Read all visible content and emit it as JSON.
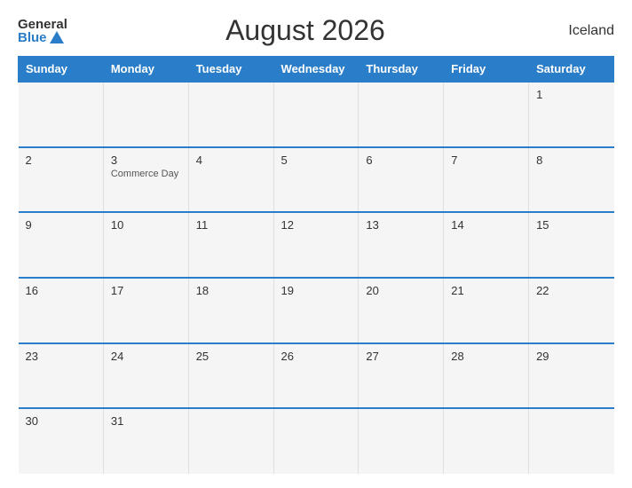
{
  "header": {
    "logo_general": "General",
    "logo_blue": "Blue",
    "title": "August 2026",
    "country": "Iceland"
  },
  "weekdays": [
    "Sunday",
    "Monday",
    "Tuesday",
    "Wednesday",
    "Thursday",
    "Friday",
    "Saturday"
  ],
  "weeks": [
    [
      {
        "day": "",
        "holiday": ""
      },
      {
        "day": "",
        "holiday": ""
      },
      {
        "day": "",
        "holiday": ""
      },
      {
        "day": "",
        "holiday": ""
      },
      {
        "day": "",
        "holiday": ""
      },
      {
        "day": "",
        "holiday": ""
      },
      {
        "day": "1",
        "holiday": ""
      }
    ],
    [
      {
        "day": "2",
        "holiday": ""
      },
      {
        "day": "3",
        "holiday": "Commerce Day"
      },
      {
        "day": "4",
        "holiday": ""
      },
      {
        "day": "5",
        "holiday": ""
      },
      {
        "day": "6",
        "holiday": ""
      },
      {
        "day": "7",
        "holiday": ""
      },
      {
        "day": "8",
        "holiday": ""
      }
    ],
    [
      {
        "day": "9",
        "holiday": ""
      },
      {
        "day": "10",
        "holiday": ""
      },
      {
        "day": "11",
        "holiday": ""
      },
      {
        "day": "12",
        "holiday": ""
      },
      {
        "day": "13",
        "holiday": ""
      },
      {
        "day": "14",
        "holiday": ""
      },
      {
        "day": "15",
        "holiday": ""
      }
    ],
    [
      {
        "day": "16",
        "holiday": ""
      },
      {
        "day": "17",
        "holiday": ""
      },
      {
        "day": "18",
        "holiday": ""
      },
      {
        "day": "19",
        "holiday": ""
      },
      {
        "day": "20",
        "holiday": ""
      },
      {
        "day": "21",
        "holiday": ""
      },
      {
        "day": "22",
        "holiday": ""
      }
    ],
    [
      {
        "day": "23",
        "holiday": ""
      },
      {
        "day": "24",
        "holiday": ""
      },
      {
        "day": "25",
        "holiday": ""
      },
      {
        "day": "26",
        "holiday": ""
      },
      {
        "day": "27",
        "holiday": ""
      },
      {
        "day": "28",
        "holiday": ""
      },
      {
        "day": "29",
        "holiday": ""
      }
    ],
    [
      {
        "day": "30",
        "holiday": ""
      },
      {
        "day": "31",
        "holiday": ""
      },
      {
        "day": "",
        "holiday": ""
      },
      {
        "day": "",
        "holiday": ""
      },
      {
        "day": "",
        "holiday": ""
      },
      {
        "day": "",
        "holiday": ""
      },
      {
        "day": "",
        "holiday": ""
      }
    ]
  ]
}
